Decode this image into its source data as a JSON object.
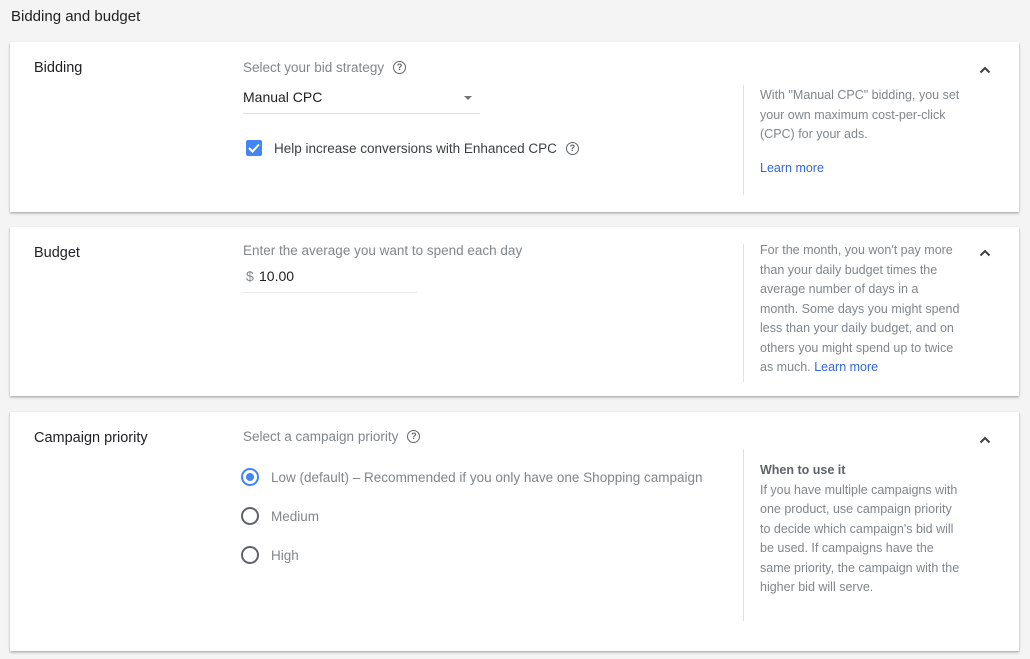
{
  "section_title": "Bidding and budget",
  "colors": {
    "accent": "#4285f4",
    "link": "#3367d6",
    "background": "#f4f4f4"
  },
  "bidding": {
    "label": "Bidding",
    "caption": "Select your bid strategy",
    "help_icon": "help-circle-icon",
    "strategy_value": "Manual CPC",
    "enhanced_cpc": {
      "label": "Help increase conversions with Enhanced CPC",
      "checked": true
    },
    "side_help": "With \"Manual CPC\" bidding, you set your own maximum cost-per-click (CPC) for your ads.",
    "learn_more": "Learn more",
    "collapse_icon": "chevron-up-icon"
  },
  "budget": {
    "label": "Budget",
    "caption": "Enter the average you want to spend each day",
    "currency": "$",
    "value": "10.00",
    "side_help": "For the month, you won't pay more than your daily budget times the average number of days in a month. Some days you might spend less than your daily budget, and on others you might spend up to twice as much.",
    "learn_more": "Learn more",
    "collapse_icon": "chevron-up-icon"
  },
  "priority": {
    "label": "Campaign priority",
    "caption": "Select a campaign priority",
    "options": [
      {
        "label": "Low (default) – Recommended if you only have one Shopping campaign",
        "selected": true
      },
      {
        "label": "Medium",
        "selected": false
      },
      {
        "label": "High",
        "selected": false
      }
    ],
    "side_title": "When to use it",
    "side_help": "If you have multiple campaigns with one product, use campaign priority to decide which campaign's bid will be used. If campaigns have the same priority, the campaign with the higher bid will serve.",
    "collapse_icon": "chevron-up-icon"
  }
}
